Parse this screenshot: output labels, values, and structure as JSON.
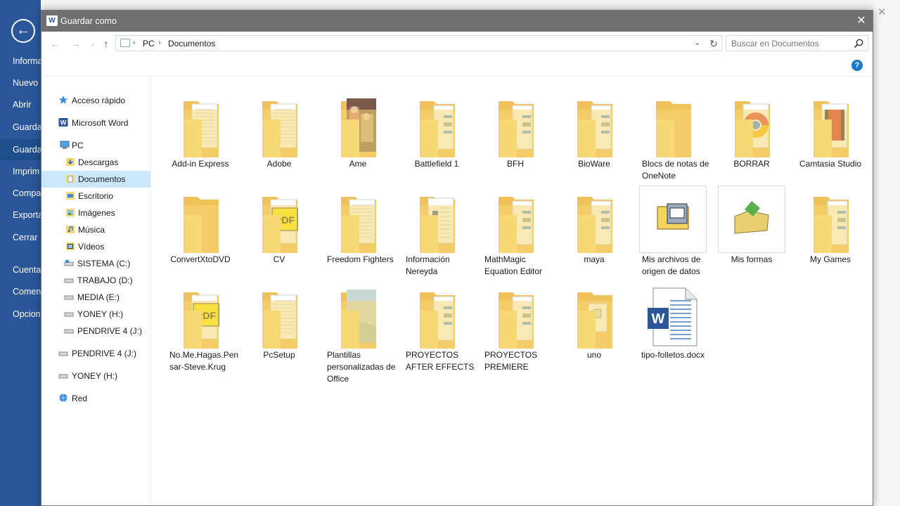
{
  "backstage": {
    "rail_items": [
      "Informa",
      "Nuevo",
      "Abrir",
      "Guardar",
      "Guardar",
      "Imprim",
      "Compa",
      "Exporta",
      "Cerrar",
      "Cuenta",
      "Coment",
      "Opcion"
    ]
  },
  "dialog": {
    "title": "Guardar como",
    "close_label": "✕",
    "address": {
      "crumbs": [
        "PC",
        "Documentos"
      ]
    },
    "search": {
      "placeholder": "Buscar en Documentos"
    },
    "help_label": "?"
  },
  "nav_pane": {
    "items": [
      {
        "label": "Acceso rápido",
        "icon": "star-icon"
      },
      {
        "label": "Microsoft Word",
        "icon": "word-icon"
      },
      {
        "label": "PC",
        "icon": "computer-icon"
      },
      {
        "label": "Descargas",
        "icon": "downloads-icon"
      },
      {
        "label": "Documentos",
        "icon": "documents-icon"
      },
      {
        "label": "Escritorio",
        "icon": "desktop-icon"
      },
      {
        "label": "Imágenes",
        "icon": "pictures-icon"
      },
      {
        "label": "Música",
        "icon": "music-icon"
      },
      {
        "label": "Vídeos",
        "icon": "videos-icon"
      },
      {
        "label": "SISTEMA (C:)",
        "icon": "drive-icon"
      },
      {
        "label": "TRABAJO (D:)",
        "icon": "drive-icon"
      },
      {
        "label": "MEDIA (E:)",
        "icon": "drive-icon"
      },
      {
        "label": "YONEY (H:)",
        "icon": "drive-icon"
      },
      {
        "label": "PENDRIVE 4 (J:)",
        "icon": "drive-icon"
      },
      {
        "label": "PENDRIVE 4 (J:)",
        "icon": "drive-icon"
      },
      {
        "label": "YONEY (H:)",
        "icon": "drive-icon"
      },
      {
        "label": "Red",
        "icon": "network-icon"
      }
    ]
  },
  "files": [
    {
      "name": "Add-in Express",
      "type": "folder-docs"
    },
    {
      "name": "Adobe",
      "type": "folder-docs"
    },
    {
      "name": "Ame",
      "type": "folder-photo"
    },
    {
      "name": "Battlefield 1",
      "type": "folder-stack"
    },
    {
      "name": "BFH",
      "type": "folder-stack"
    },
    {
      "name": "BioWare",
      "type": "folder-stack"
    },
    {
      "name": "Blocs de notas de OneNote",
      "type": "folder-empty"
    },
    {
      "name": "BORRAR",
      "type": "folder-chrome"
    },
    {
      "name": "Camtasia Studio",
      "type": "folder-film"
    },
    {
      "name": "ConvertXtoDVD",
      "type": "folder-empty"
    },
    {
      "name": "CV",
      "type": "folder-pdf"
    },
    {
      "name": "Freedom Fighters",
      "type": "folder-docs"
    },
    {
      "name": "Información Nereyda",
      "type": "folder-word"
    },
    {
      "name": "MathMagic Equation Editor",
      "type": "folder-stack"
    },
    {
      "name": "maya",
      "type": "folder-stack"
    },
    {
      "name": "Mis archivos de origen de datos",
      "type": "special-data"
    },
    {
      "name": "Mis formas",
      "type": "special-shapes"
    },
    {
      "name": "My Games",
      "type": "folder-stack"
    },
    {
      "name": "No.Me.Hagas.Pensar-Steve.Krug",
      "type": "folder-pdf"
    },
    {
      "name": "PcSetup",
      "type": "folder-docs"
    },
    {
      "name": "Plantillas personalizadas de Office",
      "type": "folder-photo2"
    },
    {
      "name": "PROYECTOS AFTER EFFECTS",
      "type": "folder-stack"
    },
    {
      "name": "PROYECTOS PREMIERE",
      "type": "folder-stack"
    },
    {
      "name": "uno",
      "type": "folder-small"
    },
    {
      "name": "tipo-folletos.docx",
      "type": "docx"
    }
  ],
  "colors": {
    "word_blue": "#2b579a",
    "folder_yellow": "#f8d775",
    "selection": "#cce8ff"
  }
}
